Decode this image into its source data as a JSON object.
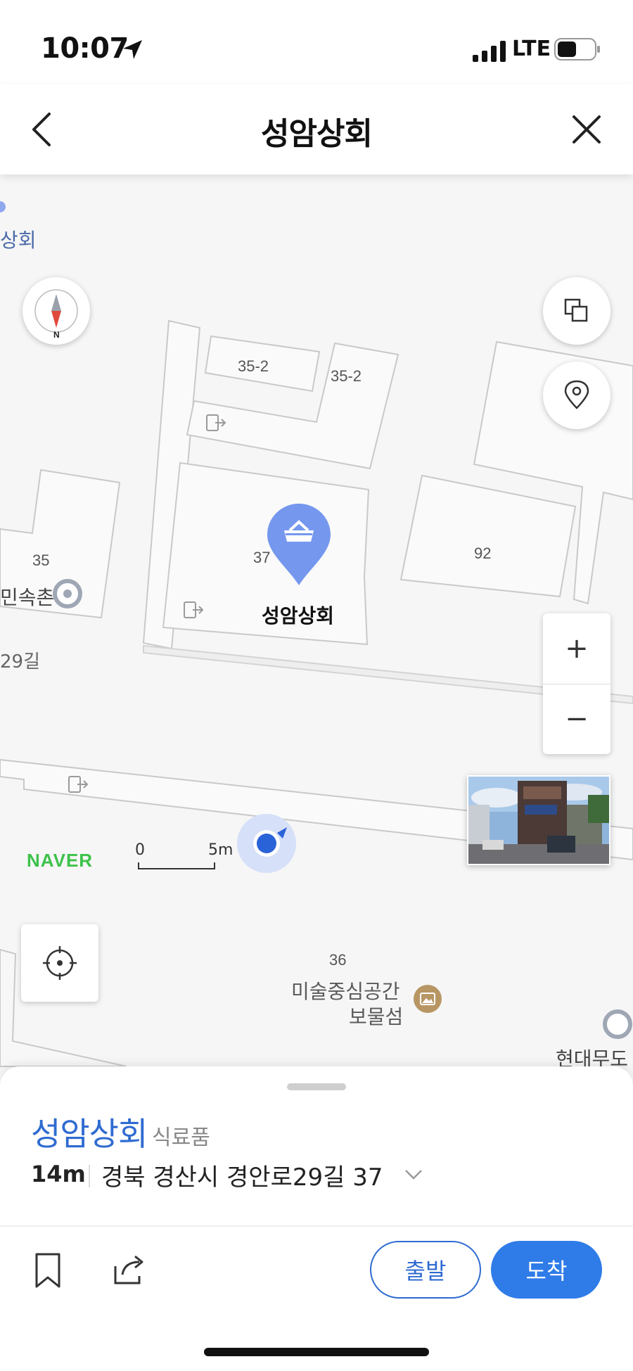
{
  "status_bar": {
    "time": "10:07",
    "network": "LTE"
  },
  "header": {
    "title": "성암상회"
  },
  "map": {
    "building_numbers": [
      "35-2",
      "35-2",
      "35",
      "37",
      "92",
      "36"
    ],
    "place_labels": {
      "top_left_partial": "상회",
      "left_partial": "민속촌",
      "road": "29길",
      "selected": "성암상회",
      "art_space_line1": "미술중심공간",
      "art_space_line2": "보물섬",
      "right_partial": "현대무도"
    },
    "zoom": {
      "plus": "+",
      "minus": "−"
    },
    "brand": "NAVER",
    "scale": {
      "start": "0",
      "end": "5m"
    }
  },
  "sheet": {
    "name": "성암상회",
    "category": "식료품",
    "distance": "14m",
    "address": "경북 경산시 경안로29길 37",
    "depart_label": "출발",
    "arrive_label": "도착"
  },
  "colors": {
    "accent": "#2f7ce8",
    "pin": "#6d93ee",
    "brand_green": "#3dc24b"
  }
}
